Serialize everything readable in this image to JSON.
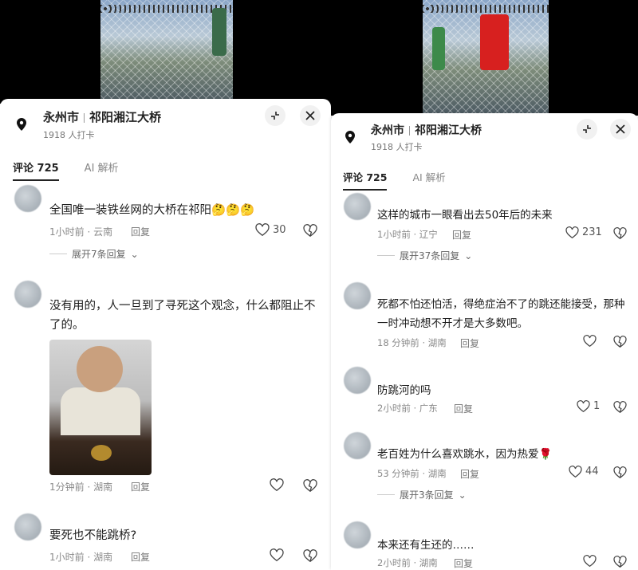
{
  "left_panel": {
    "location": {
      "city": "永州市",
      "place": "祁阳湘江大桥",
      "checkins": "1918 人打卡"
    },
    "tabs": [
      {
        "label": "评论 725"
      },
      {
        "label": "AI 解析"
      }
    ],
    "comments": [
      {
        "text": "全国唯一装铁丝网的大桥在祁阳🤔🤔🤔",
        "time": "1小时前 · 云南",
        "reply": "回复",
        "likes": "30",
        "more": "展开7条回复"
      },
      {
        "text": "没有用的，人一旦到了寻死这个观念，什么都阻止不了的。",
        "time": "1分钟前 · 湖南",
        "reply": "回复",
        "likes": ""
      },
      {
        "text": "要死也不能跳桥?",
        "time": "1小时前 · 湖南",
        "reply": "回复",
        "likes": ""
      }
    ]
  },
  "right_panel": {
    "location": {
      "city": "永州市",
      "place": "祁阳湘江大桥",
      "checkins": "1918 人打卡"
    },
    "tabs": [
      {
        "label": "评论 725"
      },
      {
        "label": "AI 解析"
      }
    ],
    "comments": [
      {
        "text": "这样的城市一眼看出去50年后的未来",
        "time": "1小时前 · 辽宁",
        "reply": "回复",
        "likes": "231",
        "more": "展开37条回复"
      },
      {
        "text": "死都不怕还怕活，得绝症治不了的跳还能接受，那种一时冲动想不开才是大多数吧。",
        "time": "18 分钟前 · 湖南",
        "reply": "回复",
        "likes": ""
      },
      {
        "text": "防跳河的吗",
        "time": "2小时前 · 广东",
        "reply": "回复",
        "likes": "1"
      },
      {
        "text": "老百姓为什么喜欢跳水，因为热爱🌹",
        "time": "53 分钟前 · 湖南",
        "reply": "回复",
        "likes": "44",
        "more": "展开3条回复"
      },
      {
        "text": "本来还有生还的……",
        "time": "2小时前 · 湖南",
        "reply": "回复",
        "likes": ""
      }
    ]
  },
  "colors": {
    "accent": "#222222",
    "muted": "#8a8a8a",
    "rose": "#d23a4a"
  }
}
